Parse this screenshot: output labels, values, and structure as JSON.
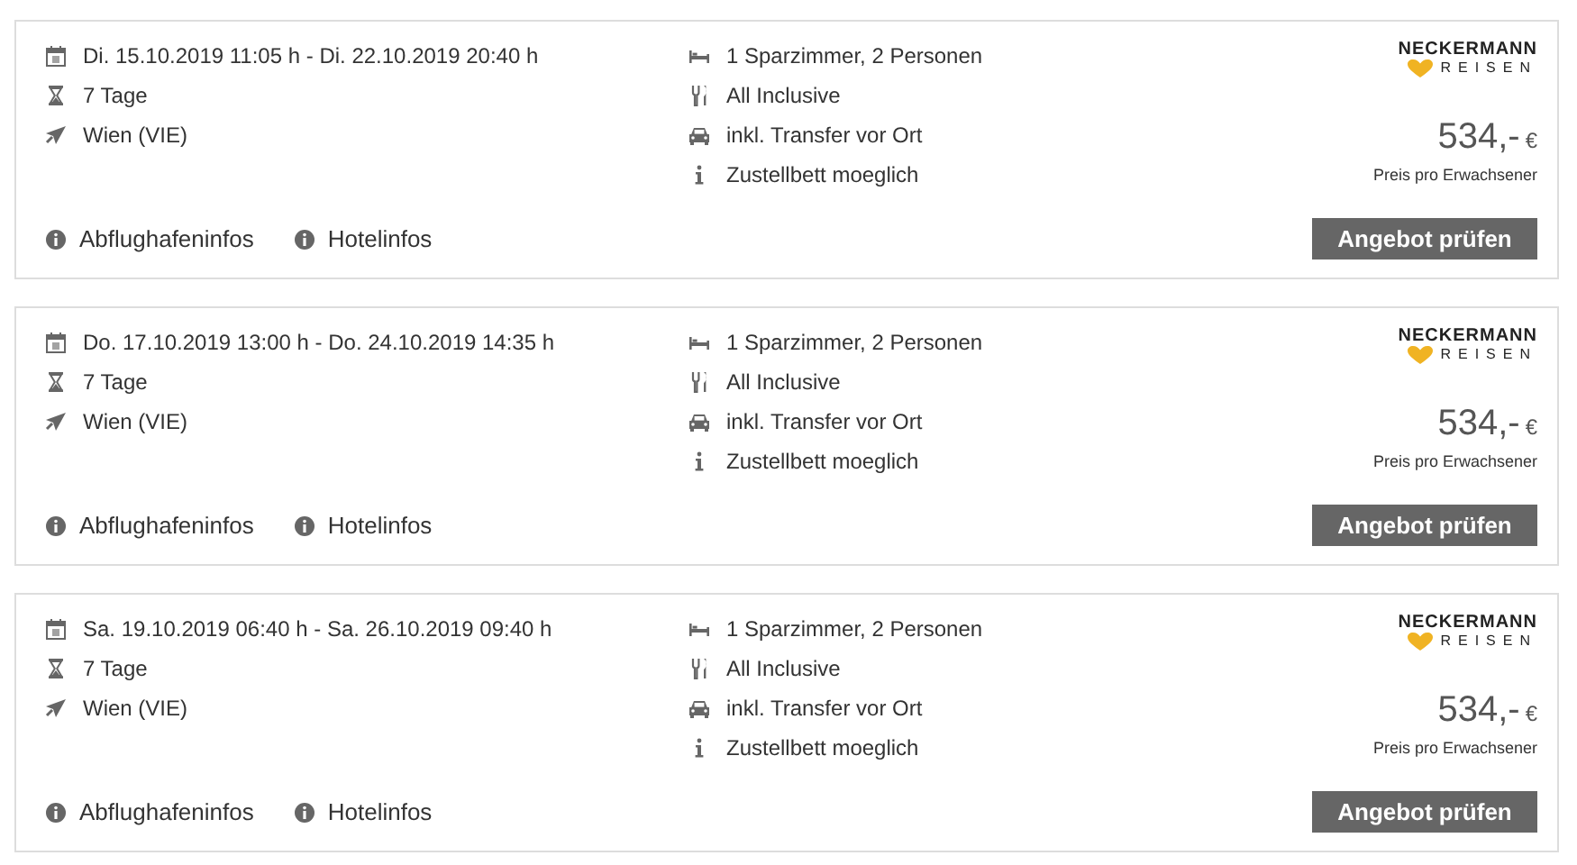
{
  "offers": [
    {
      "dates": "Di. 15.10.2019 11:05 h - Di. 22.10.2019 20:40 h",
      "duration": "7 Tage",
      "airport": "Wien (VIE)",
      "room": "1 Sparzimmer, 2 Personen",
      "board": "All Inclusive",
      "transfer": "inkl. Transfer vor Ort",
      "extra": "Zustellbett moeglich",
      "operator": {
        "name": "NECKERMANN",
        "sub": "REISEN"
      },
      "price": "534,-",
      "currency": "€",
      "price_note": "Preis pro Erwachsener",
      "button": "Angebot prüfen",
      "links": [
        "Abflughafeninfos",
        "Hotelinfos"
      ]
    },
    {
      "dates": "Do. 17.10.2019 13:00 h - Do. 24.10.2019 14:35 h",
      "duration": "7 Tage",
      "airport": "Wien (VIE)",
      "room": "1 Sparzimmer, 2 Personen",
      "board": "All Inclusive",
      "transfer": "inkl. Transfer vor Ort",
      "extra": "Zustellbett moeglich",
      "operator": {
        "name": "NECKERMANN",
        "sub": "REISEN"
      },
      "price": "534,-",
      "currency": "€",
      "price_note": "Preis pro Erwachsener",
      "button": "Angebot prüfen",
      "links": [
        "Abflughafeninfos",
        "Hotelinfos"
      ]
    },
    {
      "dates": "Sa. 19.10.2019 06:40 h - Sa. 26.10.2019 09:40 h",
      "duration": "7 Tage",
      "airport": "Wien (VIE)",
      "room": "1 Sparzimmer, 2 Personen",
      "board": "All Inclusive",
      "transfer": "inkl. Transfer vor Ort",
      "extra": "Zustellbett moeglich",
      "operator": {
        "name": "NECKERMANN",
        "sub": "REISEN"
      },
      "price": "534,-",
      "currency": "€",
      "price_note": "Preis pro Erwachsener",
      "button": "Angebot prüfen",
      "links": [
        "Abflughafeninfos",
        "Hotelinfos"
      ]
    }
  ]
}
